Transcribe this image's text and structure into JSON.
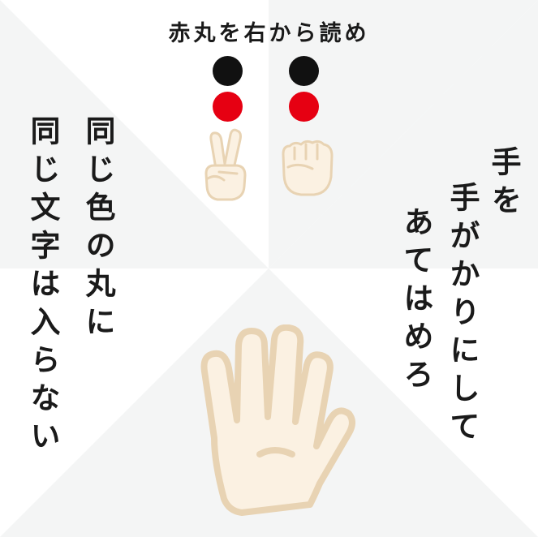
{
  "colors": {
    "background": "#ffffff",
    "pinwheel": "#f4f5f5",
    "black_dot": "#111111",
    "red_dot": "#e60012",
    "hand_fill": "#fbf1e2",
    "hand_stroke": "#e8d3b3",
    "text": "#1a1a1a"
  },
  "puzzle": {
    "title": "赤丸を右から読め",
    "left_column_dots": [
      "black",
      "red"
    ],
    "right_column_dots": [
      "black",
      "red"
    ],
    "left_hand_icon": "peace-sign-hand-icon",
    "right_hand_icon": "fist-hand-icon",
    "bottom_hand_icon": "open-palm-hand-icon"
  },
  "hints": {
    "right_line_1": "手を",
    "right_line_2": "手がかりにして",
    "right_line_3": "あてはめろ",
    "left_line_1": "同じ色の丸に",
    "left_line_2": "同じ文字は入らない",
    "right_top_word": "手"
  }
}
